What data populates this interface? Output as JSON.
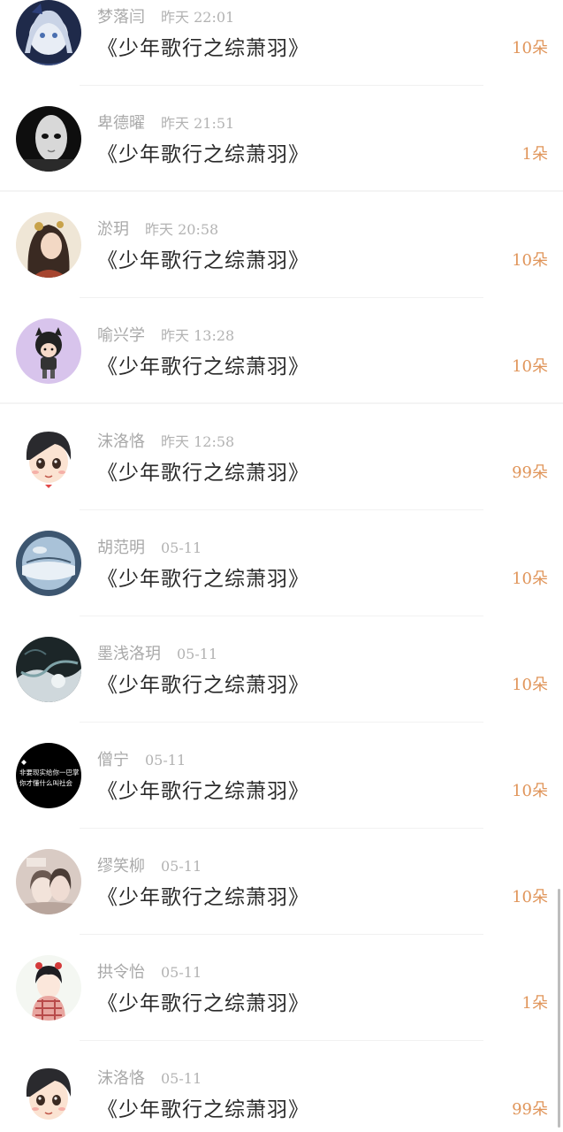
{
  "records": [
    {
      "name": "梦落闫",
      "time": "昨天 22:01",
      "gift": "《少年歌行之综萧羽》",
      "count": "10朵",
      "avatar": "anime-girl-avatar"
    },
    {
      "name": "卑德曜",
      "time": "昨天 21:51",
      "gift": "《少年歌行之综萧羽》",
      "count": "1朵",
      "avatar": "mask-avatar"
    },
    {
      "name": "淤玥",
      "time": "昨天 20:58",
      "gift": "《少年歌行之综萧羽》",
      "count": "10朵",
      "avatar": "ancient-lady-avatar"
    },
    {
      "name": "喻兴学",
      "time": "昨天 13:28",
      "gift": "《少年歌行之综萧羽》",
      "count": "10朵",
      "avatar": "cartoon-kid-avatar"
    },
    {
      "name": "沫洛恪",
      "time": "昨天 12:58",
      "gift": "《少年歌行之综萧羽》",
      "count": "99朵",
      "avatar": "cartoon-boy-avatar"
    },
    {
      "name": "胡范明",
      "time": "05-11",
      "gift": "《少年歌行之综萧羽》",
      "count": "10朵",
      "avatar": "crystal-ball-avatar"
    },
    {
      "name": "墨浅洛玥",
      "time": "05-11",
      "gift": "《少年歌行之综萧羽》",
      "count": "10朵",
      "avatar": "ink-art-avatar"
    },
    {
      "name": "僧宁",
      "time": "05-11",
      "gift": "《少年歌行之综萧羽》",
      "count": "10朵",
      "avatar": "black-text-avatar",
      "avatar_text": [
        "非要现实给你一巴掌",
        "你才懂什么叫社会"
      ]
    },
    {
      "name": "缪笑柳",
      "time": "05-11",
      "gift": "《少年歌行之综萧羽》",
      "count": "10朵",
      "avatar": "drawn-couple-avatar"
    },
    {
      "name": "拱令怡",
      "time": "05-11",
      "gift": "《少年歌行之综萧羽》",
      "count": "1朵",
      "avatar": "scarf-boy-avatar"
    },
    {
      "name": "沫洛恪",
      "time": "05-11",
      "gift": "《少年歌行之综萧羽》",
      "count": "99朵",
      "avatar": "cartoon-boy-avatar"
    }
  ],
  "colors": {
    "name": "#a9a9a9",
    "title": "#2a2a2a",
    "count": "#e0955a",
    "divider": "#f1f1f1"
  }
}
